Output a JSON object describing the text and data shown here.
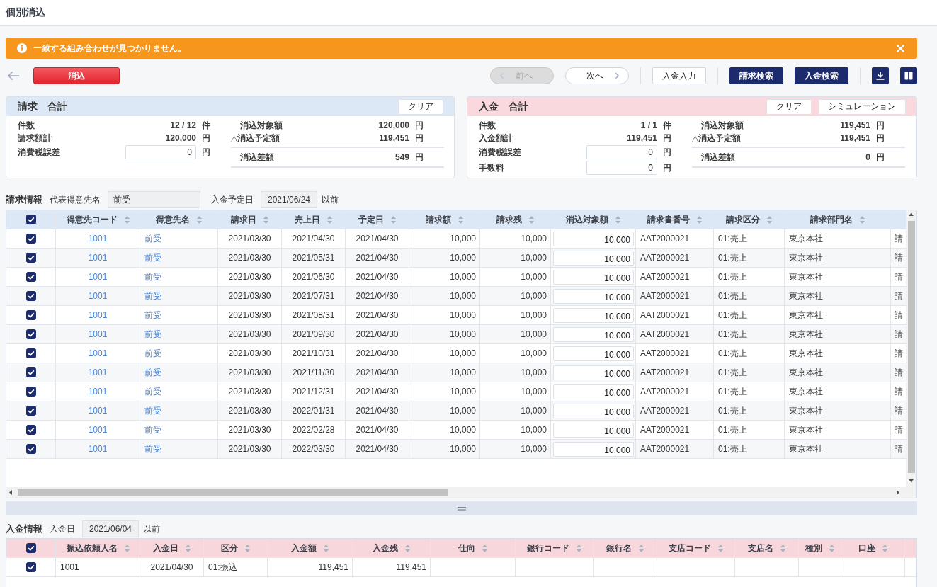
{
  "header": {
    "title": "個別消込"
  },
  "alert": {
    "message": "一致する組み合わせが見つかりません。"
  },
  "toolbar": {
    "execute": "消込",
    "pager": [
      {
        "label": "前へ",
        "kind": "prev",
        "disabled": true
      },
      {
        "label": "次へ",
        "kind": "next",
        "disabled": false
      }
    ],
    "actions": [
      {
        "label": "入金入力",
        "kind": "outline"
      },
      {
        "label": "請求検索",
        "kind": "primary"
      },
      {
        "label": "入金検索",
        "kind": "primary"
      }
    ]
  },
  "summaries": [
    {
      "kind": "billing",
      "title": "請求　合計",
      "buttons": [
        "クリア"
      ],
      "counts": [
        {
          "label": "件数",
          "value": "12 / 12",
          "unit": "件",
          "kind": "text"
        },
        {
          "label": "請求額計",
          "value": "120,000",
          "unit": "円",
          "kind": "text"
        },
        {
          "label": "消費税誤差",
          "value": "0",
          "unit": "円",
          "kind": "input"
        }
      ],
      "totals": [
        {
          "label": "消込対象額",
          "value": "120,000",
          "unit": "円"
        },
        {
          "prefix": "△",
          "label": "消込予定額",
          "value": "119,451",
          "unit": "円"
        }
      ],
      "difference": {
        "label": "消込差額",
        "value": "549",
        "unit": "円"
      }
    },
    {
      "kind": "payment",
      "title": "入金　合計",
      "buttons": [
        "クリア",
        "シミュレーション"
      ],
      "counts": [
        {
          "label": "件数",
          "value": "1 / 1",
          "unit": "件",
          "kind": "text"
        },
        {
          "label": "入金額計",
          "value": "119,451",
          "unit": "円",
          "kind": "text"
        },
        {
          "label": "消費税誤差",
          "value": "0",
          "unit": "円",
          "kind": "input"
        },
        {
          "label": "手数料",
          "value": "0",
          "unit": "円",
          "kind": "input"
        }
      ],
      "totals": [
        {
          "label": "消込対象額",
          "value": "119,451",
          "unit": "円"
        },
        {
          "prefix": "△",
          "label": "消込予定額",
          "value": "119,451",
          "unit": "円"
        }
      ],
      "difference": {
        "label": "消込差額",
        "value": "0",
        "unit": "円"
      }
    }
  ],
  "sections": [
    {
      "kind": "billing",
      "title": "請求情報",
      "filters": [
        {
          "label": "代表得意先名",
          "value": "前受",
          "kind": "name"
        },
        {
          "label": "入金予定日",
          "value": "2021/06/24",
          "kind": "date",
          "suffix": "以前"
        }
      ],
      "table": {
        "header_checked": true,
        "columns": [
          {
            "label": "得意先コード",
            "kind": "code"
          },
          {
            "label": "得意先名",
            "kind": "name"
          },
          {
            "label": "請求日",
            "kind": "date"
          },
          {
            "label": "売上日",
            "kind": "date"
          },
          {
            "label": "予定日",
            "kind": "date"
          },
          {
            "label": "請求額",
            "kind": "amount"
          },
          {
            "label": "請求残",
            "kind": "amount"
          },
          {
            "label": "消込対象額",
            "kind": "entry"
          },
          {
            "label": "請求書番号",
            "kind": "text"
          },
          {
            "label": "請求区分",
            "kind": "text"
          },
          {
            "label": "請求部門名",
            "kind": "text"
          },
          {
            "kind": "text"
          }
        ],
        "rows": [
          {
            "checked": true,
            "cells": [
              "1001",
              "前受",
              "2021/03/30",
              "2021/04/30",
              "2021/04/30",
              "10,000",
              "10,000",
              "10,000",
              "AAT2000021",
              "01:売上",
              "東京本社",
              "請"
            ]
          },
          {
            "checked": true,
            "cells": [
              "1001",
              "前受",
              "2021/03/30",
              "2021/05/31",
              "2021/04/30",
              "10,000",
              "10,000",
              "10,000",
              "AAT2000021",
              "01:売上",
              "東京本社",
              "請"
            ]
          },
          {
            "checked": true,
            "cells": [
              "1001",
              "前受",
              "2021/03/30",
              "2021/06/30",
              "2021/04/30",
              "10,000",
              "10,000",
              "10,000",
              "AAT2000021",
              "01:売上",
              "東京本社",
              "請"
            ]
          },
          {
            "checked": true,
            "cells": [
              "1001",
              "前受",
              "2021/03/30",
              "2021/07/31",
              "2021/04/30",
              "10,000",
              "10,000",
              "10,000",
              "AAT2000021",
              "01:売上",
              "東京本社",
              "請"
            ]
          },
          {
            "checked": true,
            "cells": [
              "1001",
              "前受",
              "2021/03/30",
              "2021/08/31",
              "2021/04/30",
              "10,000",
              "10,000",
              "10,000",
              "AAT2000021",
              "01:売上",
              "東京本社",
              "請"
            ]
          },
          {
            "checked": true,
            "cells": [
              "1001",
              "前受",
              "2021/03/30",
              "2021/09/30",
              "2021/04/30",
              "10,000",
              "10,000",
              "10,000",
              "AAT2000021",
              "01:売上",
              "東京本社",
              "請"
            ]
          },
          {
            "checked": true,
            "cells": [
              "1001",
              "前受",
              "2021/03/30",
              "2021/10/31",
              "2021/04/30",
              "10,000",
              "10,000",
              "10,000",
              "AAT2000021",
              "01:売上",
              "東京本社",
              "請"
            ]
          },
          {
            "checked": true,
            "cells": [
              "1001",
              "前受",
              "2021/03/30",
              "2021/11/30",
              "2021/04/30",
              "10,000",
              "10,000",
              "10,000",
              "AAT2000021",
              "01:売上",
              "東京本社",
              "請"
            ]
          },
          {
            "checked": true,
            "cells": [
              "1001",
              "前受",
              "2021/03/30",
              "2021/12/31",
              "2021/04/30",
              "10,000",
              "10,000",
              "10,000",
              "AAT2000021",
              "01:売上",
              "東京本社",
              "請"
            ]
          },
          {
            "checked": true,
            "cells": [
              "1001",
              "前受",
              "2021/03/30",
              "2022/01/31",
              "2021/04/30",
              "10,000",
              "10,000",
              "10,000",
              "AAT2000021",
              "01:売上",
              "東京本社",
              "請"
            ]
          },
          {
            "checked": true,
            "cells": [
              "1001",
              "前受",
              "2021/03/30",
              "2022/02/28",
              "2021/04/30",
              "10,000",
              "10,000",
              "10,000",
              "AAT2000021",
              "01:売上",
              "東京本社",
              "請"
            ]
          },
          {
            "checked": true,
            "cells": [
              "1001",
              "前受",
              "2021/03/30",
              "2022/03/30",
              "2021/04/30",
              "10,000",
              "10,000",
              "10,000",
              "AAT2000021",
              "01:売上",
              "東京本社",
              "請"
            ]
          }
        ]
      }
    },
    {
      "kind": "payment",
      "title": "入金情報",
      "filters": [
        {
          "label": "入金日",
          "value": "2021/06/04",
          "kind": "date",
          "suffix": "以前"
        }
      ],
      "table": {
        "header_checked": true,
        "columns": [
          {
            "label": "振込依頼人名",
            "kind": "text"
          },
          {
            "label": "入金日",
            "kind": "date"
          },
          {
            "label": "区分",
            "kind": "text"
          },
          {
            "label": "入金額",
            "kind": "amount"
          },
          {
            "label": "入金残",
            "kind": "amount"
          },
          {
            "label": "仕向",
            "kind": "text"
          },
          {
            "label": "銀行コード",
            "kind": "text"
          },
          {
            "label": "銀行名",
            "kind": "text"
          },
          {
            "label": "支店コード",
            "kind": "text"
          },
          {
            "label": "支店名",
            "kind": "text"
          },
          {
            "label": "種別",
            "kind": "text"
          },
          {
            "label": "口座",
            "kind": "text"
          }
        ],
        "rows": [
          {
            "checked": true,
            "cells": [
              "1001",
              "2021/04/30",
              "01:振込",
              "119,451",
              "119,451"
            ]
          }
        ]
      }
    }
  ]
}
